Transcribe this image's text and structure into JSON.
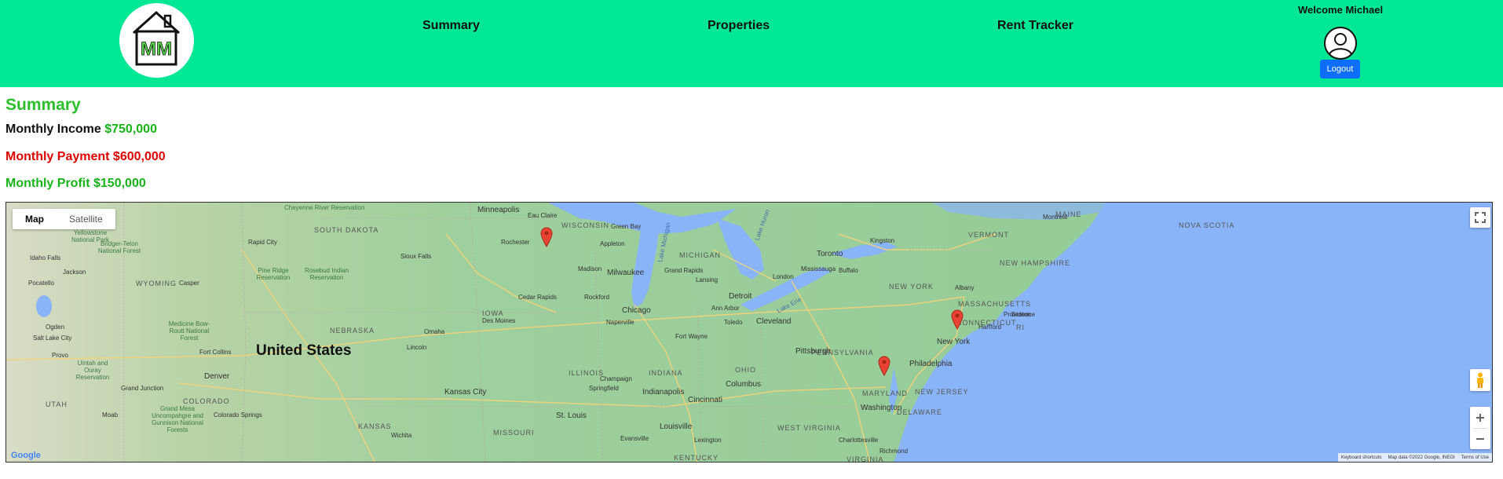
{
  "navbar": {
    "logo_text": "MM",
    "links": [
      "Summary",
      "Properties",
      "Rent Tracker"
    ],
    "welcome": "Welcome Michael",
    "logout_label": "Logout"
  },
  "summary": {
    "title": "Summary",
    "income_label": "Monthly Income",
    "income_value": "$750,000",
    "payment_label": "Monthly Payment",
    "payment_value": "$600,000",
    "profit_label": "Monthly Profit",
    "profit_value": "$150,000"
  },
  "map": {
    "type_options": [
      "Map",
      "Satellite"
    ],
    "selected_type": "Map",
    "country_label": "United States",
    "cities": [
      "Minneapolis",
      "Milwaukee",
      "Chicago",
      "Detroit",
      "Toronto",
      "Cleveland",
      "Pittsburgh",
      "Philadelphia",
      "New York",
      "Washington",
      "Kansas City",
      "St. Louis",
      "Indianapolis",
      "Cincinnati",
      "Louisville",
      "Columbus",
      "Denver",
      "Boston",
      "Buffalo",
      "Mississauga",
      "Rochester",
      "Green Bay",
      "Des Moines",
      "Omaha",
      "Fort Wayne",
      "Toledo",
      "Grand Rapids",
      "Madison",
      "Sioux Falls",
      "Richmond",
      "Cedar Rapids",
      "Lansing",
      "Fort Collins",
      "Lincoln",
      "Eau Claire",
      "Appleton",
      "Hartford",
      "Providence",
      "Albany",
      "Kingston",
      "Springfield",
      "Evansville",
      "Lexington",
      "Charlottesville",
      "Montreal",
      "Rapid City",
      "Idaho Falls",
      "Pocatello",
      "Jackson",
      "Casper",
      "Provo",
      "Salt Lake City",
      "Ogden",
      "Grand Junction",
      "Colorado Springs",
      "Moab",
      "Wichita",
      "London",
      "Naperville",
      "Rockford",
      "Champaign",
      "Ann Arbor"
    ],
    "states": [
      "WISCONSIN",
      "MICHIGAN",
      "IOWA",
      "ILLINOIS",
      "INDIANA",
      "OHIO",
      "PENNSYLVANIA",
      "NEW YORK",
      "NEW JERSEY",
      "MARYLAND",
      "DELAWARE",
      "VIRGINIA",
      "WEST VIRGINIA",
      "KENTUCKY",
      "MISSOURI",
      "KANSAS",
      "NEBRASKA",
      "SOUTH DAKOTA",
      "WYOMING",
      "COLORADO",
      "UTAH",
      "VERMONT",
      "NEW HAMPSHIRE",
      "MAINE",
      "MASSACHUSETTS",
      "CONNECTICUT",
      "RI",
      "NOVA SCOTIA"
    ],
    "park_labels": [
      "Yellowstone National Park",
      "Bridger-Teton National Forest",
      "Medicine Bow-Routt National Forest",
      "Uintah and Ouray Reservation",
      "Grand Mesa Uncompahgre and Gunnison National Forests",
      "Pine Ridge Reservation",
      "Rosebud Indian Reservation",
      "Cheyenne River Reservation"
    ],
    "water_labels": [
      "Lake Michigan",
      "Lake Huron",
      "Lake Erie"
    ],
    "markers": [
      "Rochester, MN",
      "New York, NY",
      "Washington, DC"
    ],
    "footer": {
      "shortcuts": "Keyboard shortcuts",
      "data": "Map data ©2022 Google, INEGI",
      "terms": "Terms of Use"
    },
    "google_logo": "Google"
  }
}
